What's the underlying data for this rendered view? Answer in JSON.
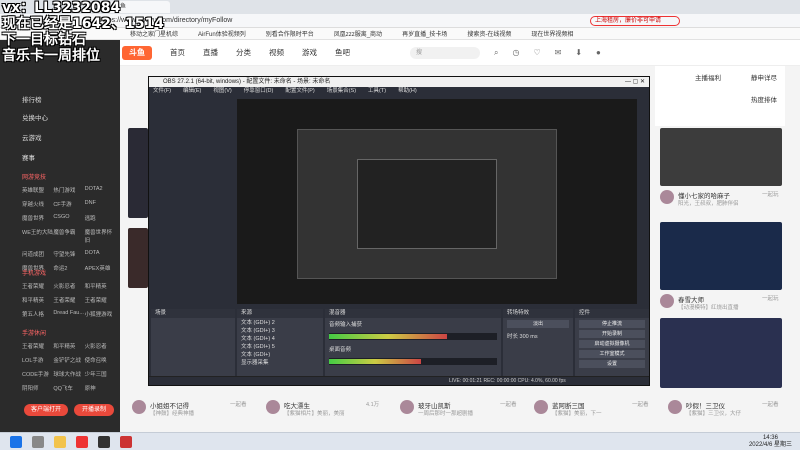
{
  "overlay": {
    "line1": "vx：LL3232084",
    "line2": "现在已经是1642、1514",
    "line3": "下一目标钻石",
    "line4": "音乐卡一周排位"
  },
  "browser": {
    "tab_title": "斗鱼",
    "url": "https://www.douyu.com/directory/myFollow",
    "search_text": "上海租房，廉价非可申请",
    "bookmarks": [
      "移动之家门星机综",
      "AirFun体验视频列",
      "别看合作限时平台",
      "凤凰zzz服离_商动",
      "再岁直播_技卡场",
      "搜索资-在线视频",
      "现在世界视频相"
    ]
  },
  "site": {
    "logo": "斗鱼",
    "nav": [
      "首页",
      "直播",
      "分类",
      "视频",
      "游戏",
      "鱼吧"
    ],
    "search_placeholder": "搜"
  },
  "sidebar": {
    "top_items": [
      "排行榜",
      "兑换中心",
      "云游戏"
    ],
    "icons_row": [
      "赛事",
      "猫",
      "杂"
    ],
    "section_hot": "网游竞技",
    "hot_games": [
      "英雄联盟",
      "热门游戏",
      "DOTA2",
      "穿越火线",
      "CF手游",
      "DNF",
      "魔兽世界",
      "CSGO",
      "逃跑",
      "WE王的大陆",
      "魔兽争霸",
      "魔兽世界怀旧",
      "问道成团",
      "守望先锋",
      "DOTA",
      "魔兽世界",
      "命运2",
      "APEX英雄"
    ],
    "section_mobile": "手机游戏",
    "mobile_games": [
      "王者荣耀",
      "火影忍者",
      "和平精英",
      "和平精英",
      "王者荣耀",
      "王者荣耀",
      "第五人格",
      "Dread Fau...",
      "小狐狸游戏"
    ],
    "section_ent": "手游休闲",
    "ent_games": [
      "王者荣耀",
      "和平精英",
      "火影忍者",
      "LOL手游",
      "金铲铲之战",
      "使命召唤",
      "CODE手游",
      "球球大作战",
      "少年三国",
      "阴阳师",
      "QQ飞车",
      "原神"
    ],
    "btn_open": "客户端打开",
    "btn_record": "开播录制"
  },
  "cards": {
    "right1_title": "懂小七家的哈麻子",
    "right1_sub": "阳光，王叔叔，肥肺伴侣",
    "right1_count": "一起玩",
    "right2_title": "春雪大师",
    "right2_sub": "【动漫模特】红烧出直播",
    "right2_count": "一起玩",
    "bottom": [
      {
        "name": "小姐姐不记得",
        "sub": "【神鼓】经典神播",
        "count": "一起看"
      },
      {
        "name": "吃大漂生",
        "sub": "【紫猫相片】美丽，美丽",
        "count": "4.1万"
      },
      {
        "name": "玻牙山凯斯",
        "sub": "一周后那时一那超剧播",
        "count": "一起看"
      },
      {
        "name": "蓝阿断三国",
        "sub": "【紫猫】美丽，下一",
        "count": "一起看"
      },
      {
        "name": "吵假！三卫仪",
        "sub": "【紫猫】三卫仪，大仔",
        "count": "一起看"
      }
    ]
  },
  "rightpanel": {
    "stream_label": "主播福利",
    "notify": "静申详尽",
    "hot": "热度排体"
  },
  "obs": {
    "title": "OBS 27.2.1 (64-bit, windows) - 配置文件: 未命名 - 场景: 未命名",
    "menu": [
      "文件(F)",
      "编辑(E)",
      "视图(V)",
      "停靠窗口(D)",
      "配置文件(P)",
      "场景集合(S)",
      "工具(T)",
      "帮助(H)"
    ],
    "scenes_header": "场景",
    "sources_header": "来源",
    "sources": [
      "文本 (GDI+) 2",
      "文本 (GDI+) 3",
      "文本 (GDI+) 4",
      "文本 (GDI+) 5",
      "文本 (GDI+)",
      "显示器采集"
    ],
    "mixer_header": "混音器",
    "mixer": [
      {
        "name": "音频输入捕获",
        "db": "0.0 dB"
      },
      {
        "name": "桌面音频",
        "db": "0.0 dB"
      }
    ],
    "transition_header": "转场特效",
    "transition": "淡出",
    "duration_label": "时长",
    "duration": "300 ms",
    "controls_header": "控件",
    "controls": [
      "停止推流",
      "开始录制",
      "启动虚拟摄像机",
      "工作室模式",
      "设置",
      "退出"
    ],
    "status": "LIVE: 00:01:21  REC: 00:00:00  CPU: 4.0%, 60.00 fps"
  },
  "taskbar": {
    "time": "14:36",
    "date": "2022/4/6 星期三"
  }
}
